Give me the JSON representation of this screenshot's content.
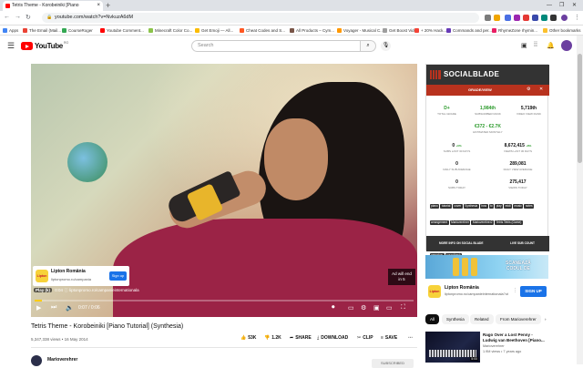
{
  "browser": {
    "tab_title": "Tetris Theme - Korobeiniki [Piano",
    "url": "youtube.com/watch?v=NvkuzA6dM",
    "bookmarks": [
      "Apps",
      "The Email (Mail...",
      "CourseRoger",
      "Youtube Comment...",
      "Minecraft Color Co...",
      "Get Emoji — All...",
      "Cheat Codes and S...",
      "All Products – Cym...",
      "Voyager - Musical C...",
      "Get Boost Video",
      "+ 20% Hack...",
      "Commands and per...",
      "RhymeZone rhymin...",
      "Other bookmarks"
    ]
  },
  "youtube": {
    "brand": "YouTube",
    "country": "RO",
    "search_placeholder": "Search"
  },
  "video": {
    "time": "0:07 / 0:06",
    "progress": 0.02,
    "title": "Tetris Theme - Korobeiniki [Piano Tutorial] (Synthesia)",
    "meta": "5,347,338 views • 16 May 2014",
    "likes": "53K",
    "dislikes": "1.2K",
    "share": "SHARE",
    "download": "DOWNLOAD",
    "clip": "CLIP",
    "save": "SAVE",
    "channel": "Marioverehrer",
    "subscribe": "SUBSCRIBED"
  },
  "video_ad": {
    "brand": "Lipton România",
    "url": "liptonpromo.ro/campania",
    "cta": "Sign up",
    "badge": "Play (k)",
    "count": "0:04",
    "detail_url": "liptonpromo.ro/campanieinternationala",
    "skip_line1": "Ad will end",
    "skip_line2": "in 5"
  },
  "socialblade": {
    "name": "SOCIALBLADE",
    "grade": "GRADE/VIEW",
    "stats_top": [
      {
        "value": "D+",
        "label": "TOTAL GRADE"
      },
      {
        "value": "1,984th",
        "label": "SUBSCRIBER RANK"
      },
      {
        "value": "5,719th",
        "label": "VIDEO VIEW RANK"
      }
    ],
    "estimate_value": "€372 - €2.7K",
    "estimate_label": "ESTIMATED MONTHLY",
    "stats_mid": [
      {
        "value": "0",
        "delta": "+0%",
        "label": "SUBS LAST 30 DAYS"
      },
      {
        "value": "8,672,415",
        "delta": "+8%",
        "label": "VIEWS LAST 30 DAYS"
      },
      {
        "value": "0",
        "label": "DAILY SUB AVERAGE"
      },
      {
        "value": "289,081",
        "label": "DAILY VIEW AVERAGE"
      },
      {
        "value": "0",
        "label": "SUBS TODAY"
      },
      {
        "value": "275,417",
        "label": "VIEWS TODAY"
      }
    ],
    "tags": [
      "piano",
      "tutorial",
      "cover",
      "Synthesia",
      "how",
      "to",
      "play",
      "midi",
      "music",
      "notes",
      "arrangement",
      "Marioverehrer",
      "Marioverehrer2",
      "Tetris Tetris (Game)",
      "Korobeiniki (Composition)",
      "Theme",
      "Theme a",
      "song",
      "melody",
      "nintendo",
      "gameboy",
      "soundtrack"
    ],
    "tags_label": "Tags",
    "footer_left": "MORE INFO ON SOCIAL BLADE",
    "footer_right": "LIVE SUB COUNT"
  },
  "side_ad": {
    "banner_line1": "SCANEAZĂ",
    "banner_line2": "CODUL DE",
    "brand": "Lipton România",
    "url": "liptonpromo.ro/campanieinternationala?ut",
    "cta": "SIGN UP"
  },
  "chips": [
    "All",
    "Synthesia",
    "Related",
    "From Marioverehrer"
  ],
  "recommended": {
    "title": "Rago Over a Lost Penny - Ludwig van Beethoven [Piano...",
    "channel": "Marioverehrer",
    "meta": "1.9M views • 7 years ago",
    "duration": "5:00"
  }
}
